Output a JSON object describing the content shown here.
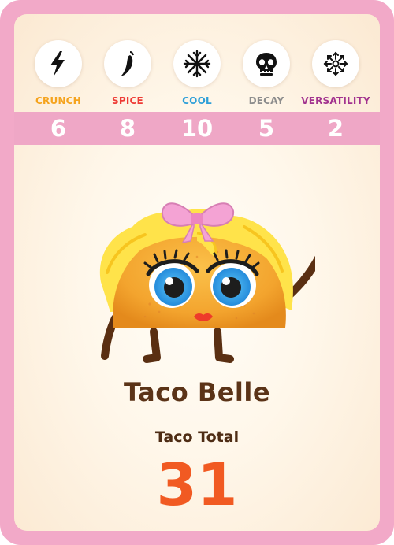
{
  "card": {
    "name": "Taco Belle",
    "total_label": "Taco Total",
    "total_value": "31",
    "frame_color": "#f2a9c8",
    "band_color": "#efa7c6",
    "total_color": "#f15a22",
    "name_color": "#5b3317"
  },
  "stats": [
    {
      "label": "CRUNCH",
      "value": "6",
      "icon": "lightning-icon",
      "color": "#f5a31d"
    },
    {
      "label": "SPICE",
      "value": "8",
      "icon": "chili-pepper-icon",
      "color": "#ee3b36"
    },
    {
      "label": "COOL",
      "value": "10",
      "icon": "snowflake-icon",
      "color": "#2e9fd8"
    },
    {
      "label": "DECAY",
      "value": "5",
      "icon": "skull-icon",
      "color": "#8d8d8d"
    },
    {
      "label": "VERSATILITY",
      "value": "2",
      "icon": "arrows-out-icon",
      "color": "#a2338f"
    }
  ],
  "character": {
    "icon": "taco-belle-character",
    "bow_color": "#f4a3d4",
    "hair_color": "#ffe34a",
    "shell_color": "#f7ad34"
  }
}
